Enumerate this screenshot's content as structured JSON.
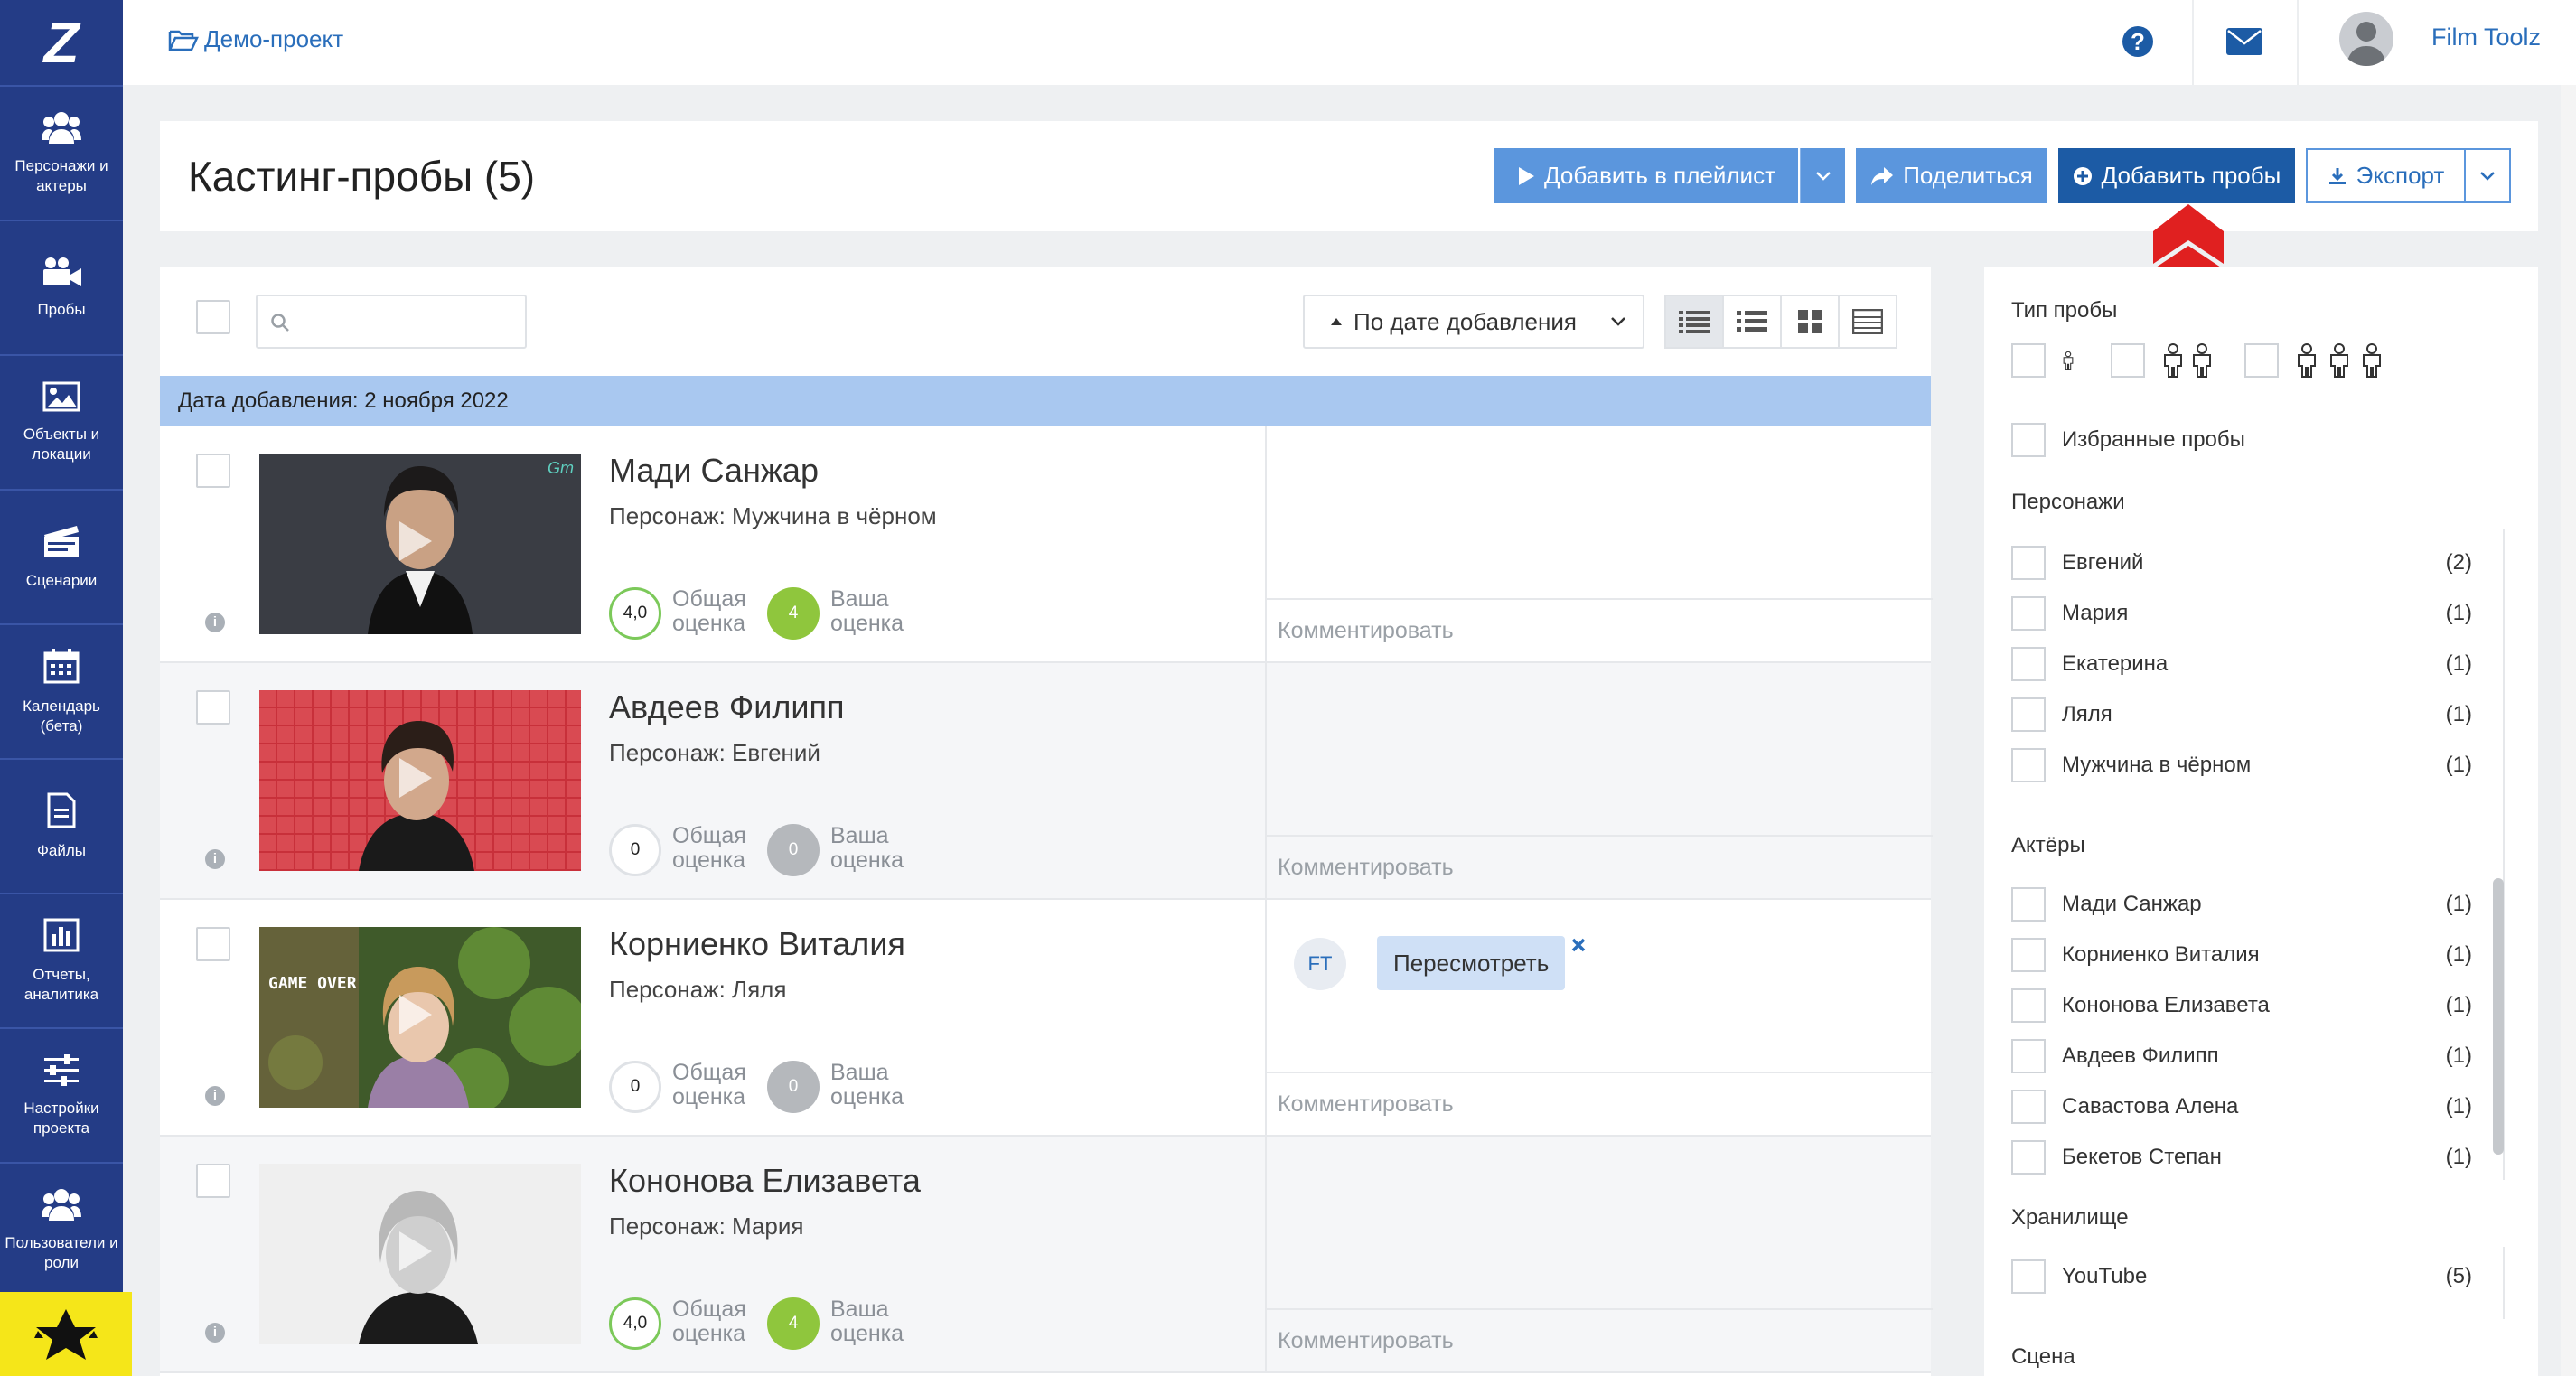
{
  "sidebar": {
    "logo": "Z",
    "items": [
      {
        "label": "Персонажи и актеры",
        "icon": "users-icon"
      },
      {
        "label": "Пробы",
        "icon": "video-camera-icon"
      },
      {
        "label": "Объекты и локации",
        "icon": "image-icon"
      },
      {
        "label": "Сценарии",
        "icon": "clapperboard-icon"
      },
      {
        "label": "Календарь (бета)",
        "icon": "calendar-icon"
      },
      {
        "label": "Файлы",
        "icon": "file-icon"
      },
      {
        "label": "Отчеты, аналитика",
        "icon": "bar-chart-icon"
      },
      {
        "label": "Настройки проекта",
        "icon": "sliders-icon"
      },
      {
        "label": "Пользователи и роли",
        "icon": "users-icon"
      }
    ]
  },
  "topbar": {
    "project": "Демо-проект",
    "user_name": "Film Toolz"
  },
  "header": {
    "title": "Кастинг-пробы (5)",
    "add_playlist": "Добавить в плейлист",
    "share": "Поделиться",
    "add_tests": "Добавить пробы",
    "export": "Экспорт"
  },
  "toolbar": {
    "search_placeholder": "",
    "sort": "По дате добавления"
  },
  "group_label": "Дата добавления: 2 ноября 2022",
  "rows": [
    {
      "name": "Мади Санжар",
      "character": "Персонаж: Мужчина в чёрном",
      "total": "4,0",
      "mine": "4",
      "comment_placeholder": "Комментировать"
    },
    {
      "name": "Авдеев Филипп",
      "character": "Персонаж: Евгений",
      "total": "0",
      "mine": "0",
      "comment_placeholder": "Комментировать"
    },
    {
      "name": "Корниенко Виталия",
      "character": "Персонаж: Ляля",
      "total": "0",
      "mine": "0",
      "comment_placeholder": "Комментировать",
      "tag_user": "FT",
      "tag": "Пересмотреть"
    },
    {
      "name": "Кононова Елизавета",
      "character": "Персонаж: Мария",
      "total": "4,0",
      "mine": "4",
      "comment_placeholder": "Комментировать"
    }
  ],
  "score_labels": {
    "total": "Общая оценка",
    "mine": "Ваша оценка"
  },
  "thumb_texts": {
    "gameover": "GAME OVER",
    "gm": "Gm"
  },
  "filters": {
    "type_title": "Тип пробы",
    "favorites": "Избранные пробы",
    "characters_title": "Персонажи",
    "characters": [
      {
        "name": "Евгений",
        "count": "(2)"
      },
      {
        "name": "Мария",
        "count": "(1)"
      },
      {
        "name": "Екатерина",
        "count": "(1)"
      },
      {
        "name": "Ляля",
        "count": "(1)"
      },
      {
        "name": "Мужчина в чёрном",
        "count": "(1)"
      }
    ],
    "actors_title": "Актёры",
    "actors": [
      {
        "name": "Мади Санжар",
        "count": "(1)"
      },
      {
        "name": "Корниенко Виталия",
        "count": "(1)"
      },
      {
        "name": "Кононова Елизавета",
        "count": "(1)"
      },
      {
        "name": "Авдеев Филипп",
        "count": "(1)"
      },
      {
        "name": "Савастова Алена",
        "count": "(1)"
      },
      {
        "name": "Бекетов Степан",
        "count": "(1)"
      }
    ],
    "storage_title": "Хранилище",
    "storage": [
      {
        "name": "YouTube",
        "count": "(5)"
      }
    ],
    "scene_title": "Сцена"
  },
  "colors": {
    "sidebar": "#243c86",
    "accent": "#1c5ba5",
    "accent_light": "#5b96dd",
    "arrow": "#e02020"
  }
}
